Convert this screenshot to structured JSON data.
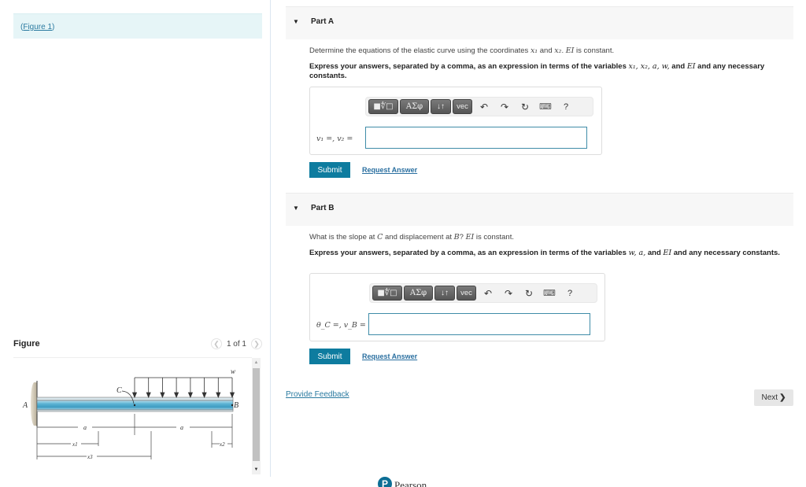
{
  "left": {
    "figure_link": {
      "open_paren": "(",
      "label": "Figure 1",
      "close_paren": ")"
    },
    "figure_panel": {
      "title": "Figure",
      "prev_icon": "chevron-left-icon",
      "next_icon": "chevron-right-icon",
      "count": "1 of 1"
    },
    "diagram": {
      "labels": {
        "A": "A",
        "B": "B",
        "C": "C",
        "w": "w",
        "a1": "a",
        "a2": "a",
        "x1": "x1",
        "x2": "x2",
        "x3": "x3"
      }
    }
  },
  "parts": [
    {
      "caret_icon": "caret-down-icon",
      "title": "Part A",
      "question_pre": "Determine the equations of the elastic curve using the coordinates ",
      "question_var1": "x₁",
      "question_mid": " and ",
      "question_var2": "x₂",
      "question_mid2": ". ",
      "question_ei": "EI",
      "question_post": " is constant.",
      "instr_pre": "Express your answers, separated by a comma, as an expression in terms of the variables ",
      "instr_vars": "x₁, x₂, a, w,",
      "instr_and": " and ",
      "instr_ei": "EI",
      "instr_post": " and any necessary constants.",
      "answer_label": "v₁ =, v₂ =",
      "answer_value": "",
      "submit_label": "Submit",
      "request_label": "Request Answer"
    },
    {
      "caret_icon": "caret-down-icon",
      "title": "Part B",
      "question_pre": "What is the slope at ",
      "question_c": "C",
      "question_mid": " and displacement at ",
      "question_b": "B",
      "question_mid2": "? ",
      "question_ei": "EI",
      "question_post": " is constant.",
      "instr_pre": "Express your answers, separated by a comma, as an expression in terms of the variables ",
      "instr_vars": "w, a,",
      "instr_and": " and ",
      "instr_ei": "EI",
      "instr_post": " and any necessary constants.",
      "answer_label": "θ_C =, v_B =",
      "answer_value": "",
      "submit_label": "Submit",
      "request_label": "Request Answer"
    }
  ],
  "toolbar": {
    "templates": "■∜□",
    "symbols": "ΑΣφ",
    "arrows": "↓↑",
    "vec": "vec",
    "undo": "↶",
    "redo": "↷",
    "reset": "↻",
    "keyboard": "⌨",
    "help": "?"
  },
  "footer": {
    "feedback_label": "Provide Feedback",
    "next_label": "Next",
    "next_chevron": "❯",
    "pearson_mark": "P",
    "pearson_word": "Pearson"
  },
  "colors": {
    "accent": "#0e7c9f",
    "link": "#2a7aa0",
    "figure_bg": "#e6f5f7"
  }
}
